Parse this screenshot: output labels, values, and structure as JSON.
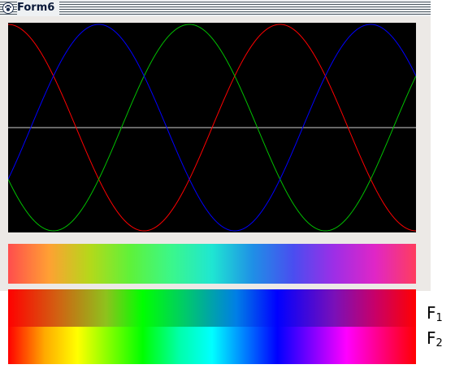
{
  "window": {
    "title": "Form6",
    "icon": "paw-icon"
  },
  "plot": {
    "type": "line",
    "background": "#000000",
    "x_periods": 1.5,
    "series": [
      {
        "color": "#ff0000",
        "phase_deg": 90
      },
      {
        "color": "#00c000",
        "phase_deg": 210
      },
      {
        "color": "#0000ff",
        "phase_deg": 330
      }
    ],
    "midline_color": "#d0d0d0"
  },
  "legend": {
    "f1": {
      "main": "F",
      "sub": "1"
    },
    "f2": {
      "main": "F",
      "sub": "2"
    }
  }
}
